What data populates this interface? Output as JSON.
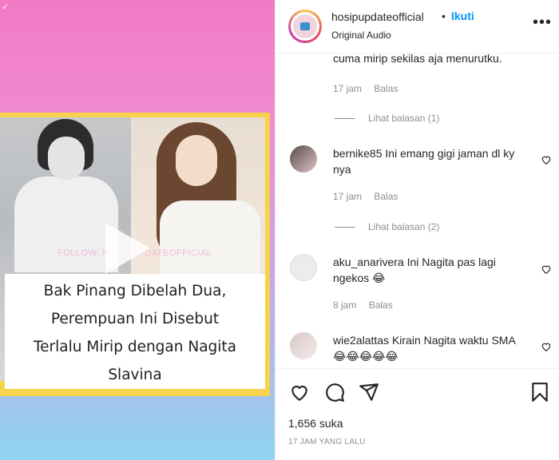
{
  "post": {
    "watermark": "FOLLOW: HOSIPUPDATEOFFICIAL",
    "caption": [
      "Bak Pinang Dibelah Dua,",
      "Perempuan Ini Disebut",
      "Terlalu Mirip dengan Nagita",
      "Slavina"
    ]
  },
  "header": {
    "username": "hosipupdateofficial",
    "separator": "•",
    "follow_label": "Ikuti",
    "audio": "Original Audio",
    "more_icon": "more-horizontal-icon"
  },
  "comments": [
    {
      "partial_text": "cuma mirip sekilas aja menurutku.",
      "time": "17 jam",
      "reply_label": "Balas",
      "view_replies": "Lihat balasan (1)"
    },
    {
      "username": "bernike85",
      "text": "Ini emang gigi jaman dl ky nya",
      "time": "17 jam",
      "reply_label": "Balas",
      "view_replies": "Lihat balasan (2)"
    },
    {
      "username": "aku_anarivera",
      "text": "Ini Nagita pas lagi ngekos 😂",
      "time": "8 jam",
      "reply_label": "Balas"
    },
    {
      "username": "wie2alattas",
      "text": "Kirain Nagita waktu SMA 😂😂😂😂😂"
    }
  ],
  "actions": {
    "likes": "1,656 suka",
    "timestamp": "17 JAM YANG LALU",
    "icons": [
      "heart-icon",
      "comment-icon",
      "share-icon",
      "bookmark-icon"
    ]
  },
  "colors": {
    "accent": "#0095f6",
    "muted": "#8e8e8e",
    "text": "#262626",
    "card_yellow": "#f6d34a"
  }
}
